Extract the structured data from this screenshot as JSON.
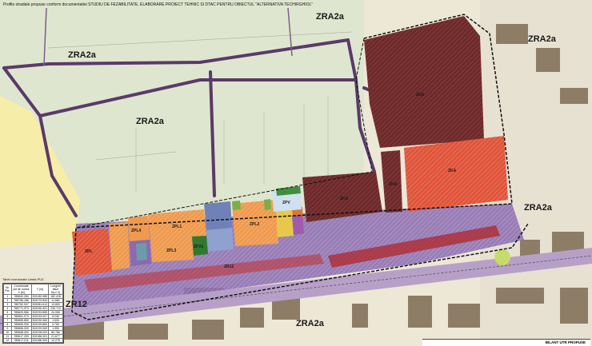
{
  "header": {
    "caption": "Profile stradale propuse conform documentatiei STUDIU DE FEZABILITATE, ELABORARE PROIECT TEHNIC SI DTAC PENTRU OBIECTUL \"ALTERNATIVA TECHIRGHIOL\""
  },
  "zones": {
    "zra2a_top_right": "ZRA2a",
    "zra2a_top_left": "ZRA2a",
    "zra2a_mid": "ZRA2a",
    "zra2a_right": "ZRA2a",
    "zra2a_bottom": "ZRA2a",
    "zr12": "ZR12",
    "zka_main": "ZKA",
    "zka_mid": "ZKA",
    "zka_narrow": "ZKA",
    "zka_right": "ZKA",
    "zpv": "ZPV",
    "zpl1": "ZPL1",
    "zpl2": "ZPL2",
    "zpl3": "ZPL3",
    "zpl4": "ZPL4",
    "zpl_left": "ZPL",
    "zfv1": "ZFV1",
    "zr_road": "ZR12"
  },
  "coord_table": {
    "title": "Tabel coordonate Limita PUZ",
    "headers": [
      "Nr. Pct.",
      "Coordonate pct.de contur X [m]",
      "Y [m]",
      "Lungimi laturi D(i,i+1)"
    ],
    "rows": [
      [
        "1",
        "785840.284",
        "302180.985",
        "182.418"
      ],
      [
        "2",
        "785756.186",
        "302079.834",
        "11.684"
      ],
      [
        "3",
        "785752.007",
        "302081.612",
        "13.809"
      ],
      [
        "4",
        "785771.973",
        "302090.491",
        "230.713"
      ],
      [
        "5",
        "785629.556",
        "302233.855",
        "24.059"
      ],
      [
        "6",
        "785651.073",
        "302233.007",
        "8.230"
      ],
      [
        "7",
        "785655.850",
        "302230.960",
        "1.500"
      ],
      [
        "8",
        "785655.930",
        "302229.860",
        "0.760"
      ],
      [
        "9",
        "785656.009",
        "302229.069",
        "1.950"
      ],
      [
        "10",
        "785658.000",
        "302228.000",
        "80.766"
      ],
      [
        "11",
        "785617.209",
        "302186.301",
        "21.677"
      ],
      [
        "12",
        "785617.011",
        "302186.900",
        "10.278"
      ]
    ]
  },
  "legend": {
    "title": "BILANT UTR PROPUSE"
  },
  "colors": {
    "background": "#f4f1e8",
    "field": "#d9e3c6",
    "boundary": "#111111",
    "zka": "#7a2a2a",
    "zpl": "#f0a05a",
    "purple": "#8a6ab0",
    "red": "#d84a3a",
    "road": "#5a3a6a"
  }
}
